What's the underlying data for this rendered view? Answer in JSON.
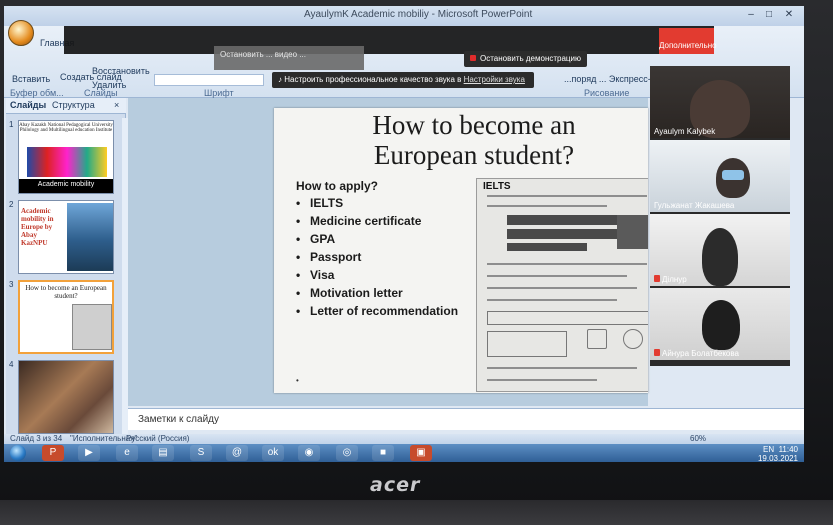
{
  "window": {
    "title": "AyaulymK Academic mobiliy - Microsoft PowerPoint"
  },
  "ribbon": {
    "tab_home": "Главная",
    "paste": "Вставить",
    "create_slide": "Создать слайд",
    "restore": "Восстановить",
    "delete": "Удалить",
    "clipboard": "Буфер обм...",
    "slides": "Слайды",
    "font": "Шрифт",
    "drawing": "Рисование",
    "express_styles": "...поряд ... Экспресс-стили"
  },
  "overlays": {
    "stop_demo": "Остановить демонстрацию",
    "red_button": "Дополнительно",
    "notice": "Настроить профессиональное качество звука в",
    "notice_link": "Настройки звука",
    "gray_popup": "Остановить ... видео ..."
  },
  "side_panel": {
    "tab_slides": "Слайды",
    "tab_structure": "Структура",
    "thumbs": [
      {
        "num": "1",
        "title": "Abay Kazakh National Pedagogical University Philology and Multilingual education Institute",
        "caption": "Academic mobility"
      },
      {
        "num": "2",
        "title": "Academic mobility in Europe by Abay KazNPU"
      },
      {
        "num": "3",
        "title": "How to become an European student?"
      },
      {
        "num": "4"
      }
    ]
  },
  "slide": {
    "title": "How to become an European student?",
    "apply_heading": "How to apply?",
    "bullets": [
      "IELTS",
      "Medicine certificate",
      "GPA",
      "Passport",
      "Visa",
      "Motivation letter",
      "Letter of recommendation"
    ],
    "doc_heading": "IELTS"
  },
  "participants": [
    {
      "name": "Ayaulym Kalybek",
      "muted": false
    },
    {
      "name": "Гульжанат Жакашева",
      "muted": false
    },
    {
      "name": "Ділнур",
      "muted": true
    },
    {
      "name": "Айнура Болатбекова",
      "muted": true
    }
  ],
  "notes": {
    "placeholder": "Заметки к слайду"
  },
  "status": {
    "slide_counter": "Слайд 3 из 34",
    "theme": "\"Исполнительная\"",
    "language": "Русский (Россия)",
    "zoom": "60%"
  },
  "taskbar": {
    "lang": "EN",
    "time": "11:40",
    "date": "19.03.2021"
  },
  "laptop": {
    "brand": "acer"
  }
}
